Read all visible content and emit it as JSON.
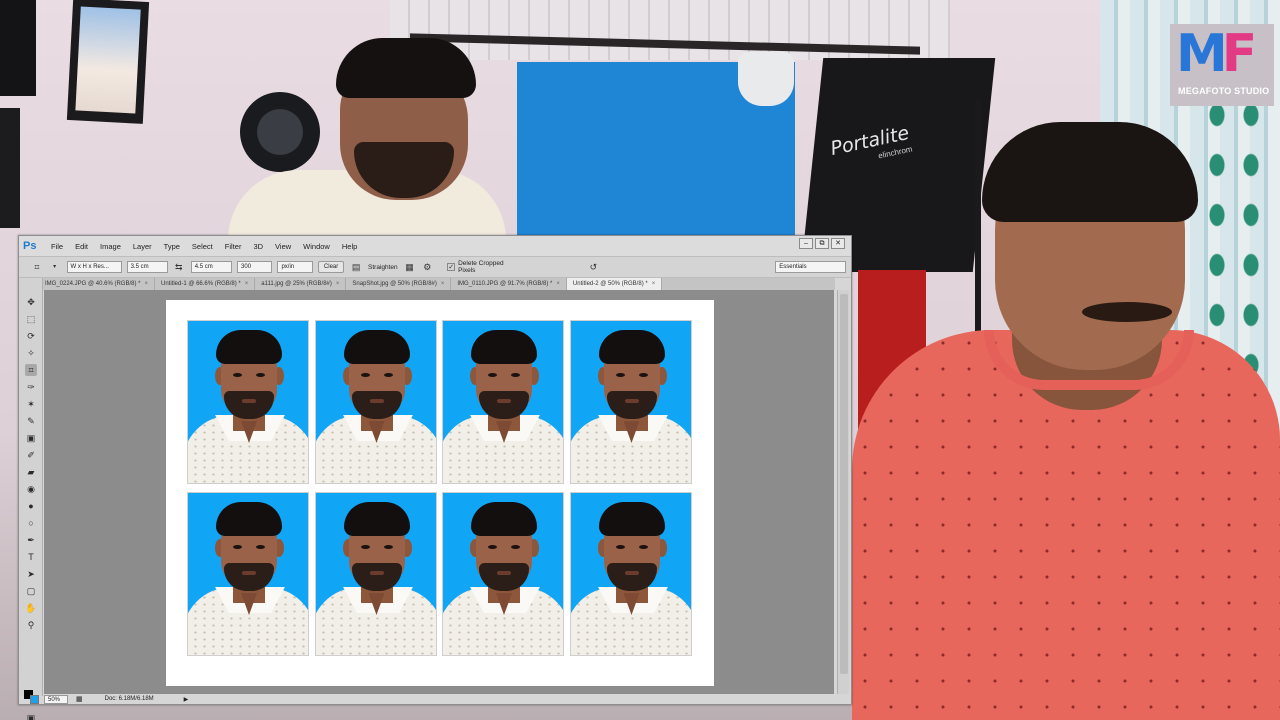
{
  "overlay": {
    "logo_mark_left": "M",
    "logo_mark_right": "F",
    "logo_caption": "MEGAFOTO STUDIO",
    "softbox_brand": "Portalite",
    "softbox_sub": "elinchrom"
  },
  "photoshop": {
    "app_logo": "Ps",
    "menu": [
      "File",
      "Edit",
      "Image",
      "Layer",
      "Type",
      "Select",
      "Filter",
      "3D",
      "View",
      "Window",
      "Help"
    ],
    "window_controls": [
      "–",
      "⧉",
      "✕"
    ],
    "options_bar": {
      "crop_preset": "W x H x Res...",
      "width_value": "3.5 cm",
      "height_value": "4.5 cm",
      "resolution_value": "300",
      "resolution_unit": "px/in",
      "clear_label": "Clear",
      "straighten_label": "Straighten",
      "delete_cropped_label": "Delete Cropped Pixels",
      "delete_cropped_checked": true,
      "workspace": "Essentials"
    },
    "tabs": [
      {
        "label": "IMG_0224.JPG @ 40.6% (RGB/8) *",
        "active": false
      },
      {
        "label": "Untitled-1 @ 66.6% (RGB/8) *",
        "active": false
      },
      {
        "label": "a111.jpg @ 25% (RGB/8#)",
        "active": false
      },
      {
        "label": "SnapShot.jpg @ 50% (RGB/8#)",
        "active": false
      },
      {
        "label": "IMG_0110.JPG @ 91.7% (RGB/8) *",
        "active": false
      },
      {
        "label": "Untitled-2 @ 50% (RGB/8) *",
        "active": true
      }
    ],
    "tab_close": "×",
    "status": {
      "zoom": "50%",
      "doc_size": "Doc: 6.18M/6.18M",
      "arrow": "▶"
    },
    "background_color": "#21a0e8",
    "photo_background": "#10a5f5",
    "photos_count": 8
  }
}
